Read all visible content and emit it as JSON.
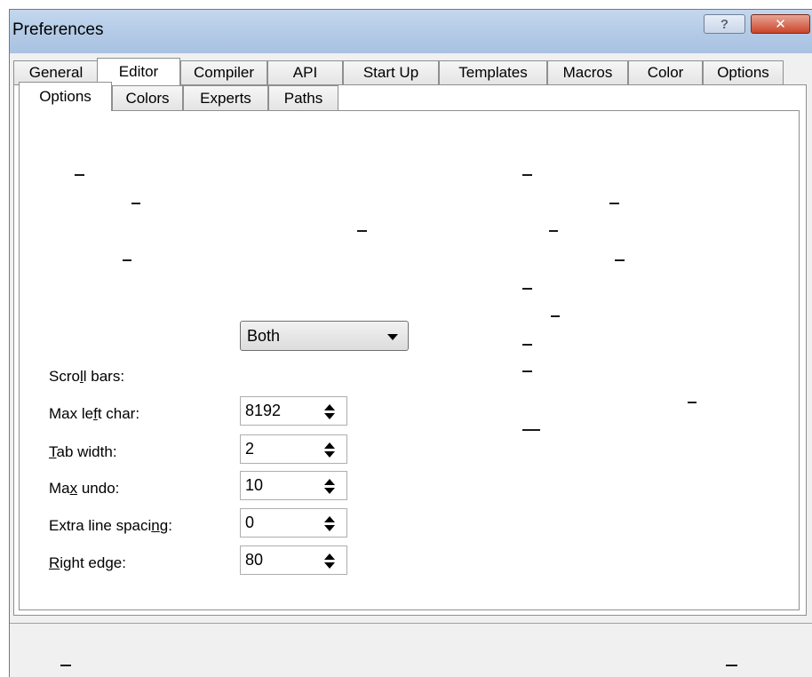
{
  "window": {
    "title": "Preferences",
    "help_label": "?",
    "close_label": "✕"
  },
  "tabs": [
    {
      "label": "General",
      "active": false
    },
    {
      "label": "Editor",
      "active": true
    },
    {
      "label": "Compiler",
      "active": false
    },
    {
      "label": "API",
      "active": false
    },
    {
      "label": "Start Up",
      "active": false
    },
    {
      "label": "Templates",
      "active": false
    },
    {
      "label": "Macros",
      "active": false
    },
    {
      "label": "Color",
      "active": false
    },
    {
      "label": "Options",
      "active": false
    }
  ],
  "subtabs": [
    {
      "label": "Options",
      "active": true
    },
    {
      "label": "Colors",
      "active": false
    },
    {
      "label": "Experts",
      "active": false
    },
    {
      "label": "Paths",
      "active": false
    }
  ],
  "fields": {
    "scroll_bars": {
      "pre": "Scro",
      "ul": "l",
      "post": "l bars:",
      "value": "Both"
    },
    "max_left_char": {
      "pre": "Max le",
      "ul": "f",
      "post": "t char:",
      "value": "8192"
    },
    "tab_width": {
      "pre": "",
      "ul": "T",
      "post": "ab width:",
      "value": "2"
    },
    "max_undo": {
      "pre": "Ma",
      "ul": "x",
      "post": " undo:",
      "value": "10"
    },
    "extra_line_spacing": {
      "pre": "Extra line spaci",
      "ul": "n",
      "post": "g:",
      "value": "0"
    },
    "right_edge": {
      "pre": "",
      "ul": "R",
      "post": "ight edge:",
      "value": "80"
    }
  }
}
